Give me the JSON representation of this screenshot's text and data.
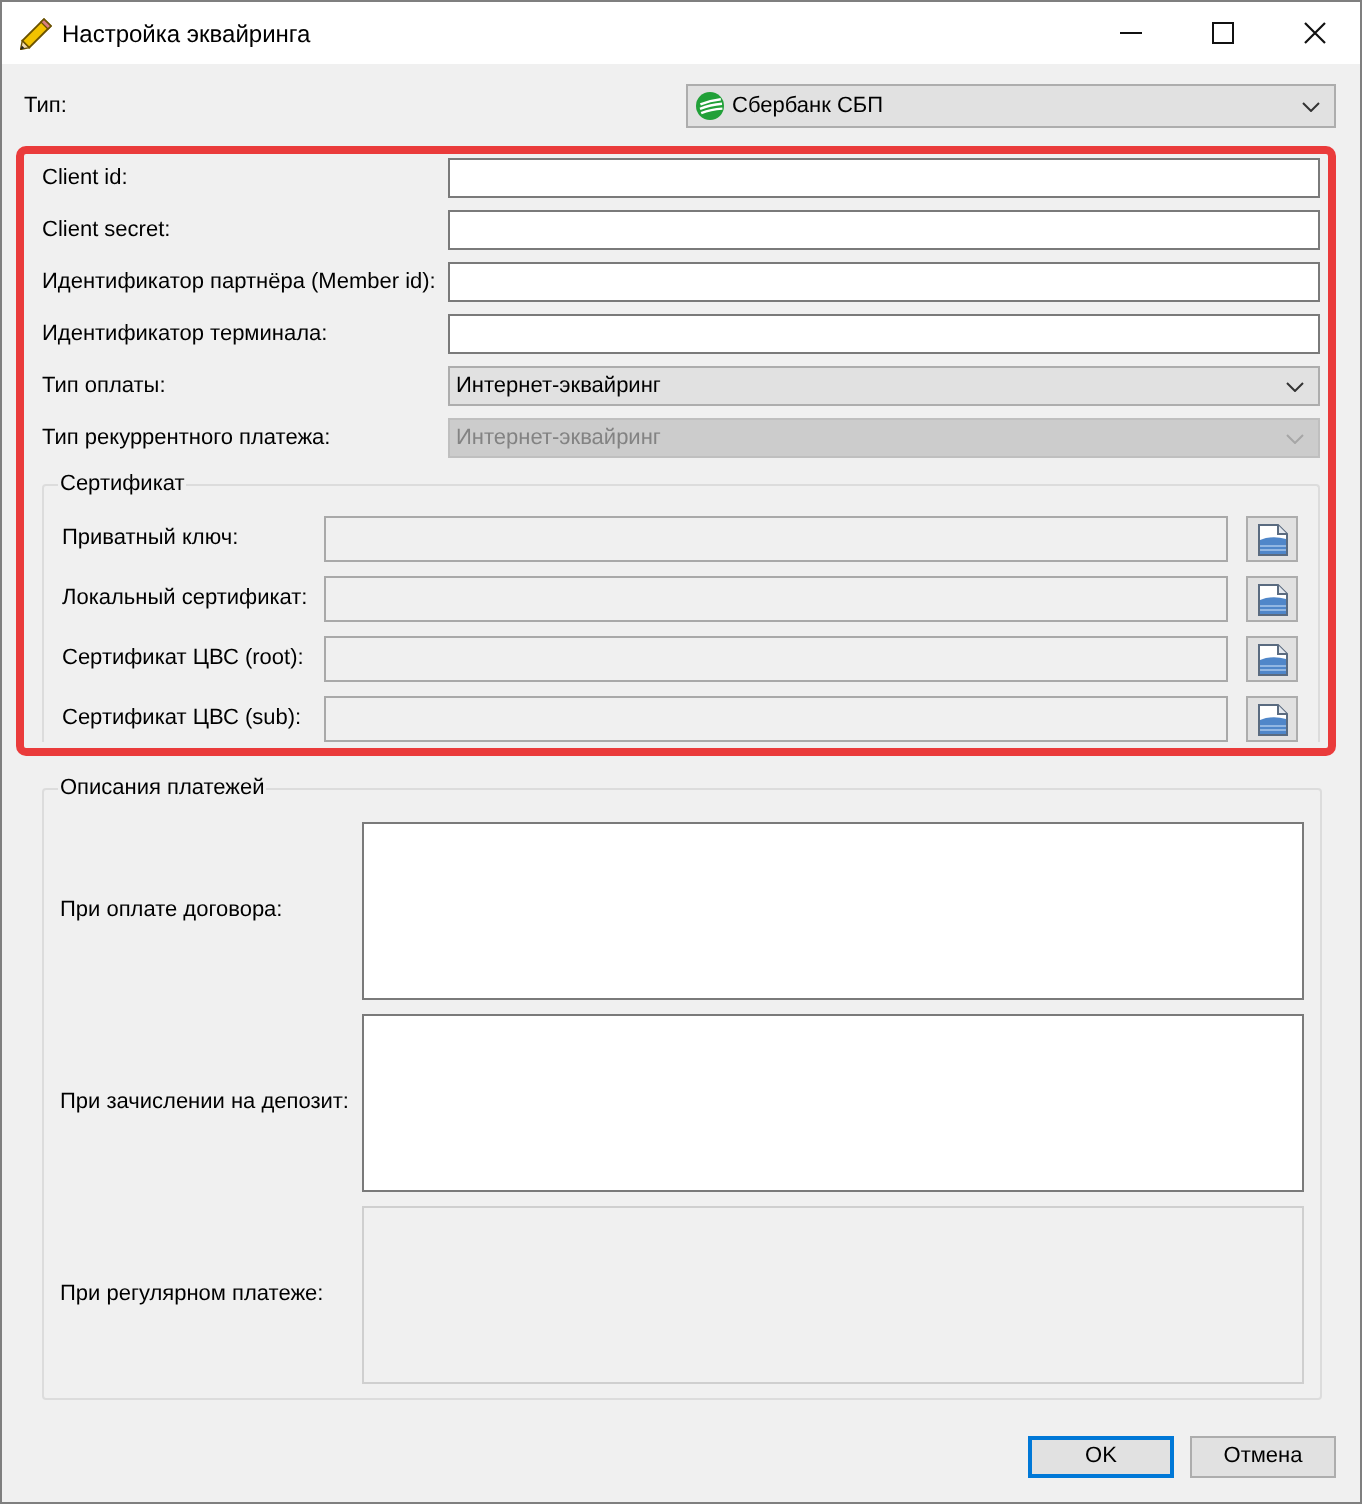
{
  "window": {
    "title": "Настройка эквайринга"
  },
  "type_field": {
    "label": "Тип:",
    "value": "Сбербанк СБП"
  },
  "settings": {
    "highlighted": true,
    "fields": [
      {
        "kind": "text",
        "label": "Client id:",
        "disabled": false
      },
      {
        "kind": "text",
        "label": "Client secret:",
        "disabled": false
      },
      {
        "kind": "text",
        "label": "Идентификатор партнёра (Member id):",
        "disabled": false
      },
      {
        "kind": "text",
        "label": "Идентификатор терминала:",
        "disabled": false
      },
      {
        "kind": "select",
        "label": "Тип оплаты:",
        "value": "Интернет-эквайринг",
        "disabled": false
      },
      {
        "kind": "select",
        "label": "Тип рекуррентного платежа:",
        "value": "Интернет-эквайринг",
        "disabled": true
      }
    ],
    "certificate": {
      "title": "Сертификат",
      "fields": [
        {
          "label": "Приватный ключ:",
          "disabled": true
        },
        {
          "label": "Локальный сертификат:",
          "disabled": true
        },
        {
          "label": "Сертификат ЦВС (root):",
          "disabled": true
        },
        {
          "label": "Сертификат ЦВС (sub):",
          "disabled": true
        }
      ]
    }
  },
  "descriptions": {
    "title": "Описания платежей",
    "fields": [
      {
        "label": "При оплате договора:",
        "disabled": false
      },
      {
        "label": "При зачислении на депозит:",
        "disabled": false
      },
      {
        "label": "При регулярном платеже:",
        "disabled": true
      }
    ]
  },
  "buttons": [
    {
      "label": "OK",
      "default": true
    },
    {
      "label": "Отмена",
      "default": false
    }
  ]
}
